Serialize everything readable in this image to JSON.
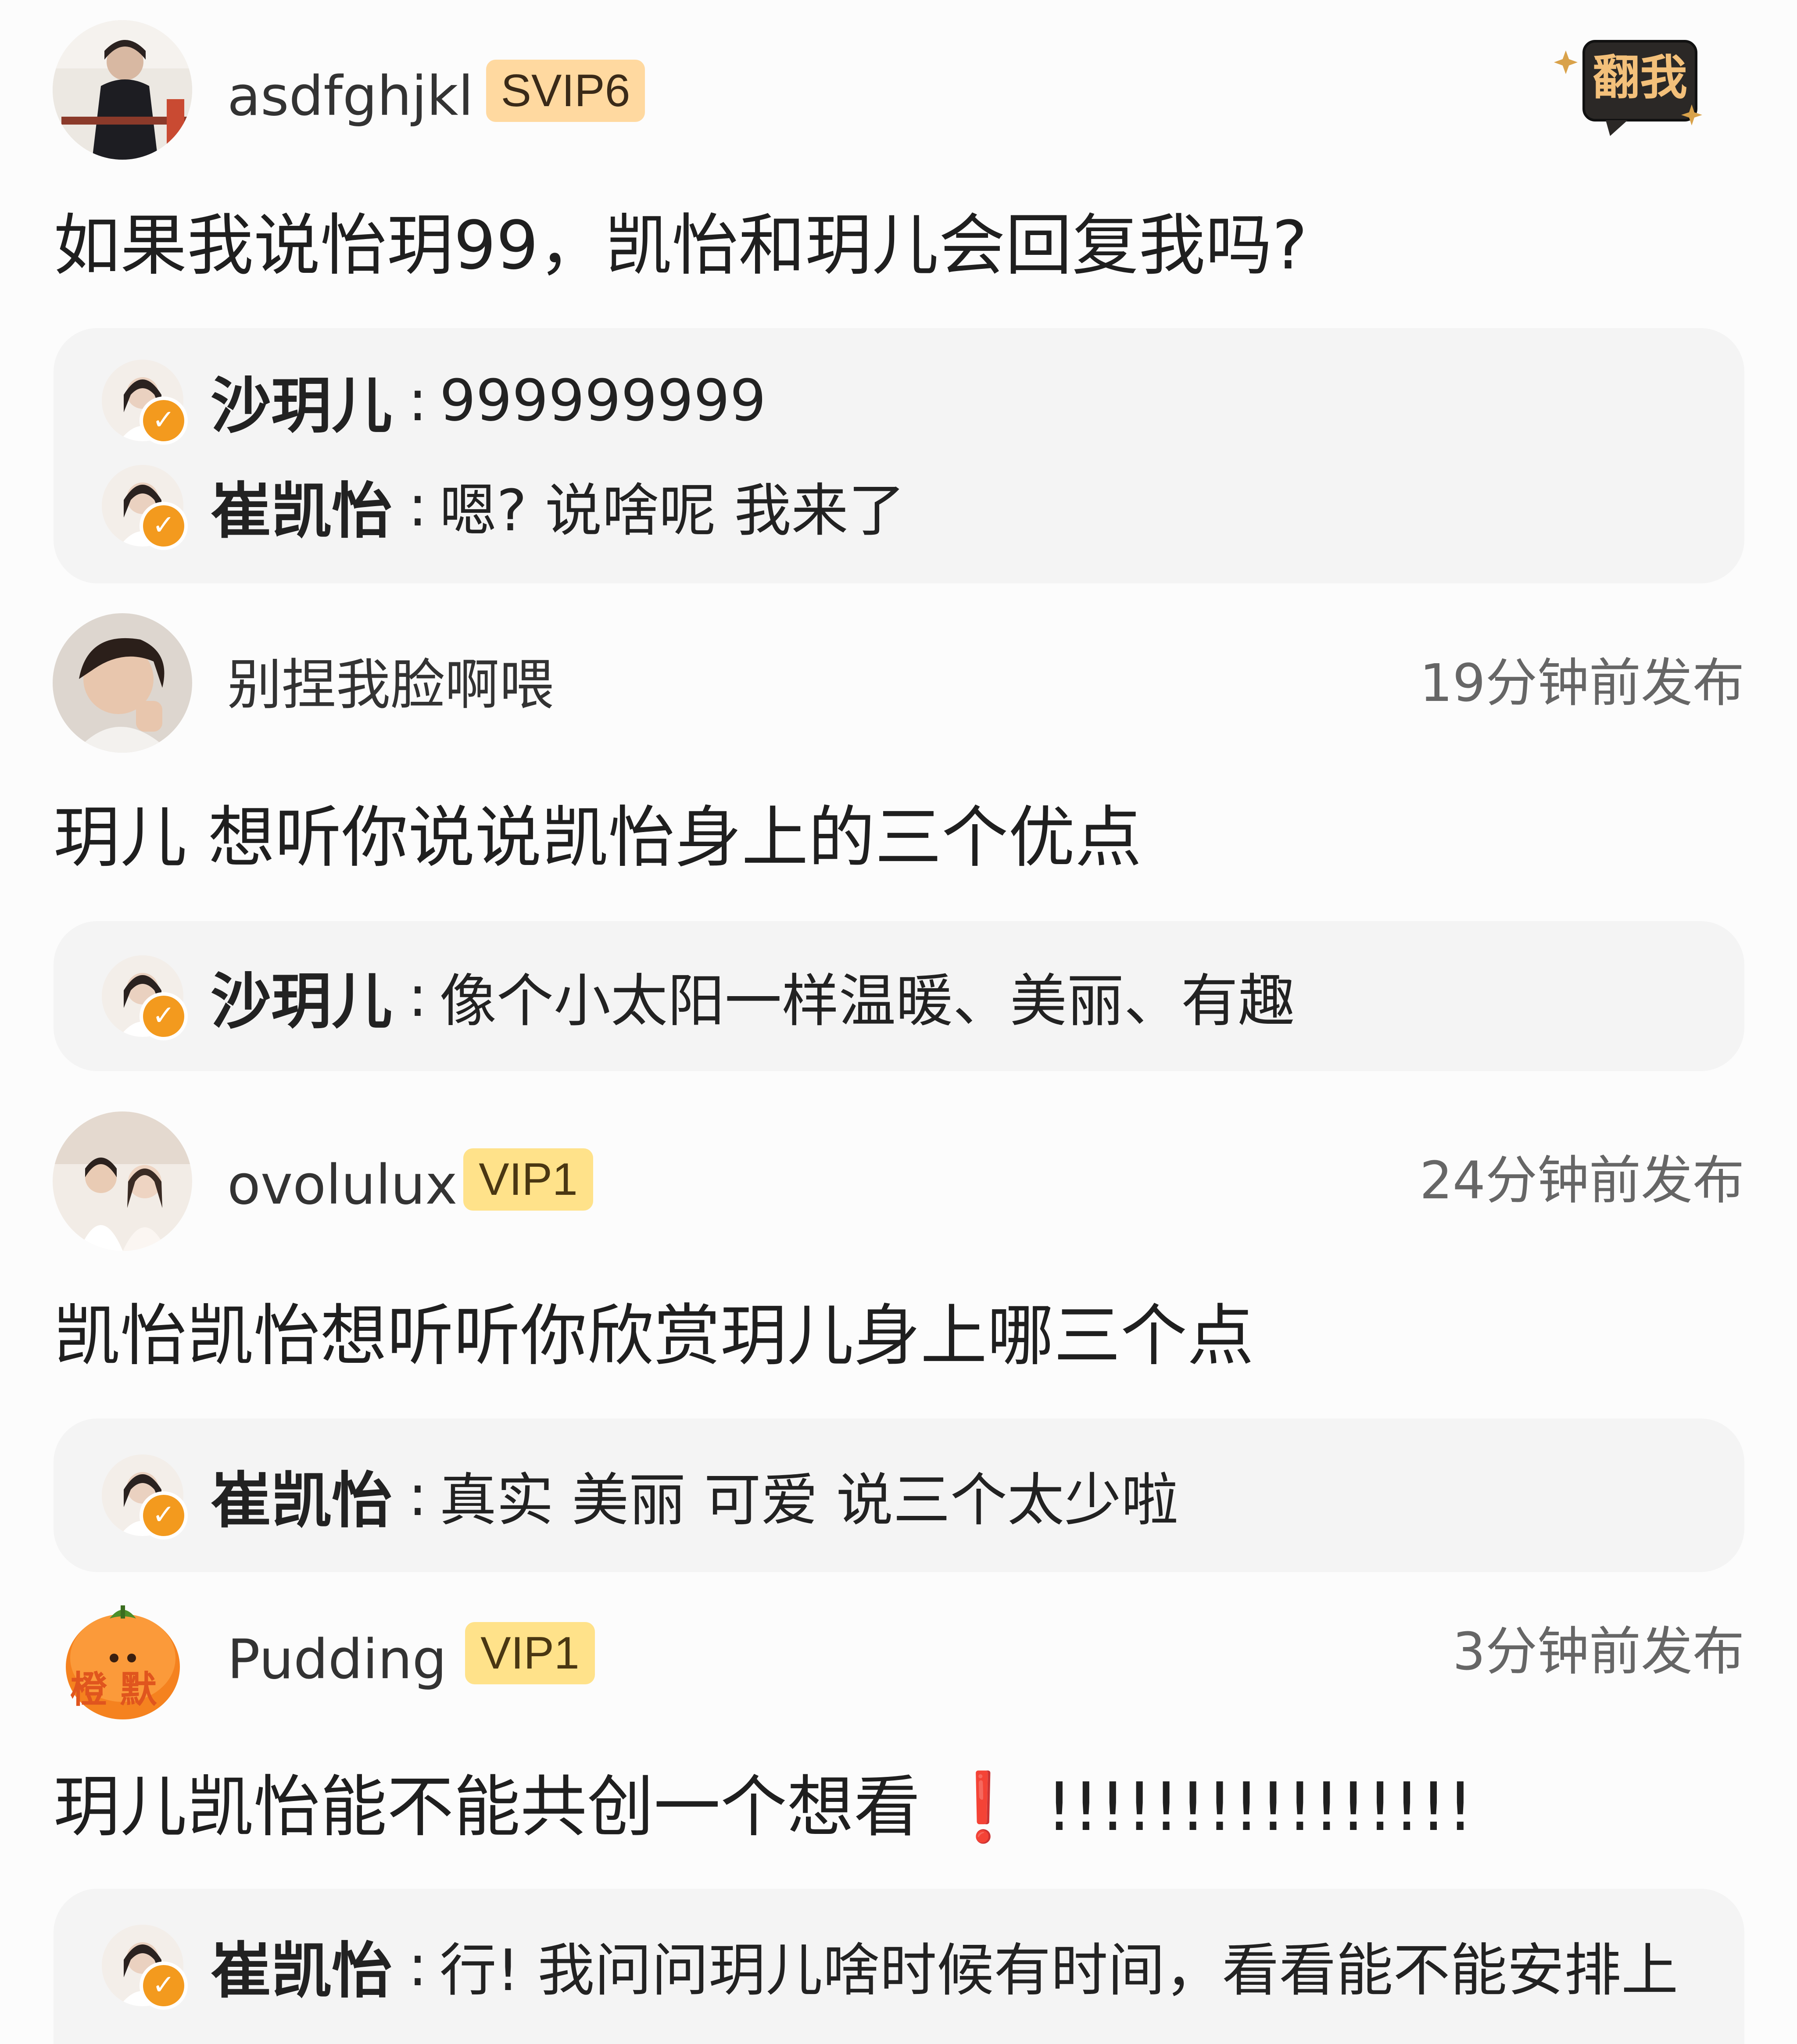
{
  "header_button": {
    "label": "翻我",
    "icon": "sparkle-icon"
  },
  "colors": {
    "svip_badge": "#ffd9a0",
    "vip_badge": "#ffe28a",
    "verified_badge": "#f39a1e",
    "reply_box": "#f4f4f4",
    "exclaim": "#e02020"
  },
  "threads": [
    {
      "user": "asdfghjkl",
      "badge": "SVIP6",
      "time": "",
      "comment": "如果我说怡玥99，凯怡和玥儿会回复我吗?",
      "replies": [
        {
          "name": "沙玥儿",
          "colon": ":",
          "text": "999999999"
        },
        {
          "name": "崔凯怡",
          "colon": ":",
          "text": "嗯? 说啥呢 我来了"
        }
      ]
    },
    {
      "user": "别捏我脸啊喂",
      "badge": "",
      "time": "19分钟前发布",
      "comment": "玥儿 想听你说说凯怡身上的三个优点",
      "replies": [
        {
          "name": "沙玥儿",
          "colon": ":",
          "text": "像个小太阳一样温暖、美丽、有趣"
        }
      ]
    },
    {
      "user": "ovolulux",
      "badge": "VIP1",
      "time": "24分钟前发布",
      "comment": "凯怡凯怡想听听你欣赏玥儿身上哪三个点",
      "replies": [
        {
          "name": "崔凯怡",
          "colon": ":",
          "text": "真实 美丽 可爱 说三个太少啦"
        }
      ]
    },
    {
      "user": "Pudding",
      "badge": "VIP1",
      "time": "3分钟前发布",
      "avatar_text": "橙 默",
      "comment": "玥儿凯怡能不能共创一个想看",
      "comment_exclaim": "❗",
      "comment_tail": "!!!!!!!!!!!!!!!!",
      "replies": [
        {
          "name": "崔凯怡",
          "colon": ":",
          "text": "行! 我问问玥儿啥时候有时间，看看能不能安排上"
        }
      ]
    }
  ]
}
